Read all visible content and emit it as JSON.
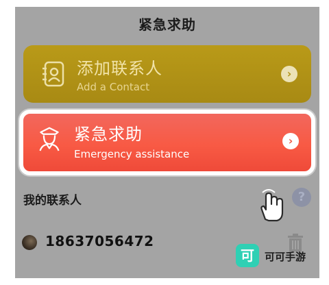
{
  "header": {
    "title": "紧急求助"
  },
  "cards": {
    "add": {
      "title": "添加联系人",
      "subtitle": "Add a Contact",
      "icon": "contact-card-icon"
    },
    "emergency": {
      "title": "紧急求助",
      "subtitle": "Emergency assistance",
      "icon": "police-officer-icon"
    }
  },
  "contacts": {
    "label": "我的联系人",
    "help_icon": "question-icon",
    "items": [
      {
        "phone": "18637056472"
      }
    ]
  },
  "watermark": {
    "logo_char": "可",
    "text": "可可手游"
  },
  "glyphs": {
    "chevron": "›",
    "question": "?"
  },
  "colors": {
    "screen_bg": "#a4a4a4",
    "add_card": "#b99a18",
    "emergency_card": "#f85a44",
    "watermark_logo": "#2fd0b4"
  }
}
